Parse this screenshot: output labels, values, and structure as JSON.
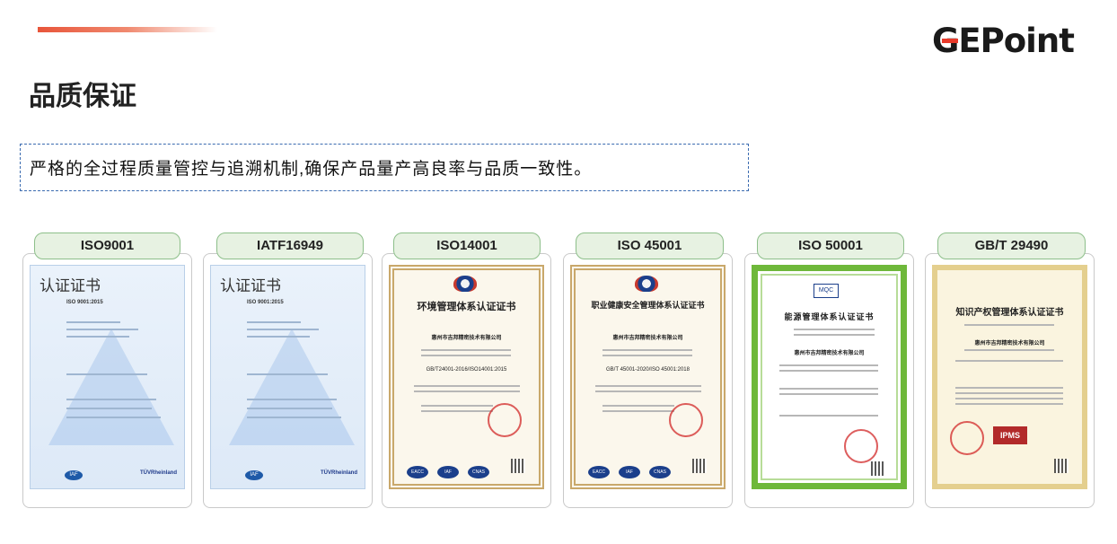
{
  "brand": {
    "name": "GEPoint",
    "accent": "#e83a2a"
  },
  "page": {
    "title": "品质保证"
  },
  "slogan": "严格的全过程质量管控与追溯机制,确保产品量产高良率与品质一致性。",
  "certificates": [
    {
      "label": "ISO9001",
      "doc_title": "认证证书",
      "doc_standard": "ISO 9001:2015"
    },
    {
      "label": "IATF16949",
      "doc_title": "认证证书",
      "doc_standard": "ISO 9001:2015"
    },
    {
      "label": "ISO14001",
      "doc_title": "环境管理体系认证证书",
      "company": "惠州市吉邦精密技术有限公司",
      "doc_standard": "GB/T24001-2016/ISO14001:2015"
    },
    {
      "label": "ISO 45001",
      "doc_title": "职业健康安全管理体系认证证书",
      "company": "惠州市吉邦精密技术有限公司",
      "doc_standard": "GB/T 45001-2020/ISO 45001:2018"
    },
    {
      "label": "ISO 50001",
      "doc_title": "能源管理体系认证证书",
      "company": "惠州市吉邦精密技术有限公司"
    },
    {
      "label": "GB/T  29490",
      "doc_title": "知识产权管理体系认证证书",
      "company": "惠州市吉邦精密技术有限公司"
    }
  ]
}
